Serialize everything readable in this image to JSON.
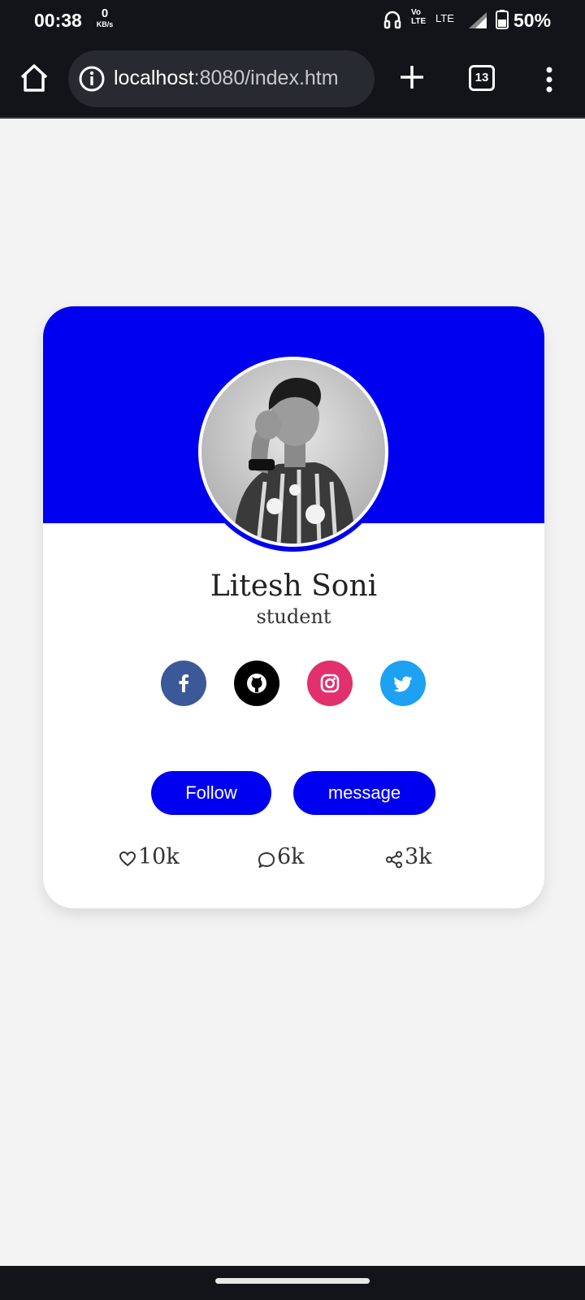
{
  "status_bar": {
    "time": "00:38",
    "net_speed_value": "0",
    "net_speed_unit": "KB/s",
    "volte_top": "Vo",
    "volte_bottom": "LTE",
    "lte": "LTE",
    "battery": "50%"
  },
  "browser": {
    "url_host": "localhost",
    "url_rest": ":8080/index.htm",
    "tab_count": "13"
  },
  "profile": {
    "name": "Litesh Soni",
    "role": "student",
    "header_color": "#0000f0"
  },
  "social_links": [
    {
      "name": "facebook",
      "icon": "facebook-icon",
      "color": "#3b5998"
    },
    {
      "name": "github",
      "icon": "github-icon",
      "color": "#000000"
    },
    {
      "name": "instagram",
      "icon": "instagram-icon",
      "color": "#e1306c"
    },
    {
      "name": "twitter",
      "icon": "twitter-icon",
      "color": "#1da1f2"
    }
  ],
  "buttons": {
    "follow": "Follow",
    "message": "message"
  },
  "stats": {
    "likes": "10k",
    "comments": "6k",
    "shares": "3k"
  }
}
